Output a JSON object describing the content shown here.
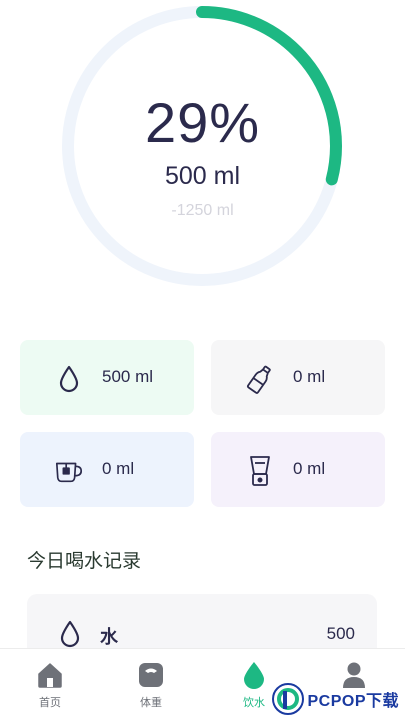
{
  "progress": {
    "percent_label": "29%",
    "fraction": 0.29,
    "amount": "500 ml",
    "remaining": "-1250 ml",
    "track_color": "#eff4fb",
    "fill_color": "#1db883"
  },
  "drinks": [
    {
      "icon": "water-drop-icon",
      "value": "500 ml",
      "color": "#edfbf3"
    },
    {
      "icon": "bottle-icon",
      "value": "0 ml",
      "color": "#f6f6f7"
    },
    {
      "icon": "tea-cup-icon",
      "value": "0 ml",
      "color": "#edf3fd"
    },
    {
      "icon": "blender-icon",
      "value": "0 ml",
      "color": "#f5f1fb"
    }
  ],
  "records_title": "今日喝水记录",
  "records": [
    {
      "icon": "water-drop-icon",
      "name": "水",
      "value": "500"
    }
  ],
  "tabs": [
    {
      "label": "首页",
      "icon": "home-icon"
    },
    {
      "label": "体重",
      "icon": "scale-icon"
    },
    {
      "label": "饮水",
      "icon": "water-drop-icon",
      "active": true
    },
    {
      "label": "",
      "icon": "profile-icon"
    }
  ],
  "watermark": {
    "text": "PCPOP下载"
  }
}
